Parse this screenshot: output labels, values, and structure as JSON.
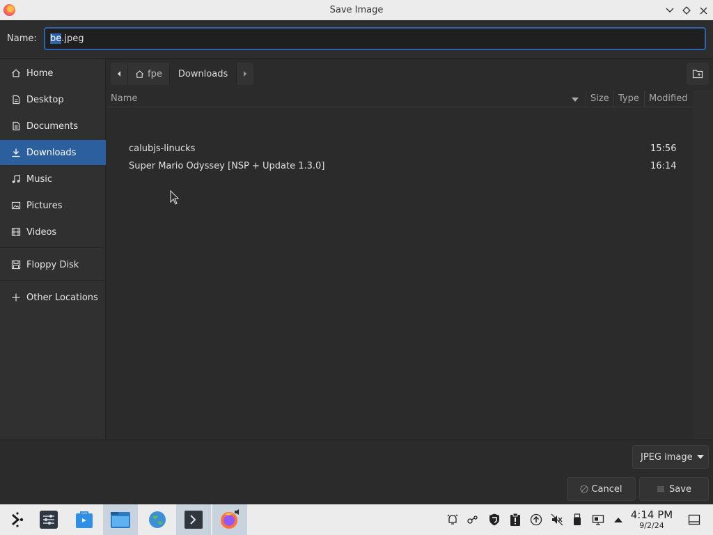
{
  "window": {
    "title": "Save Image",
    "controls": [
      "minimize",
      "restore",
      "close"
    ]
  },
  "name_field": {
    "label": "Name:",
    "value_selected": "be",
    "value_rest": ".jpeg"
  },
  "sidebar": {
    "items": [
      {
        "label": "Home",
        "icon": "home-icon",
        "active": false
      },
      {
        "label": "Desktop",
        "icon": "desktop-icon",
        "active": false
      },
      {
        "label": "Documents",
        "icon": "documents-icon",
        "active": false
      },
      {
        "label": "Downloads",
        "icon": "downloads-icon",
        "active": true
      },
      {
        "label": "Music",
        "icon": "music-icon",
        "active": false
      },
      {
        "label": "Pictures",
        "icon": "pictures-icon",
        "active": false
      },
      {
        "label": "Videos",
        "icon": "videos-icon",
        "active": false
      },
      {
        "label": "Floppy Disk",
        "icon": "floppy-icon",
        "active": false
      },
      {
        "label": "Other Locations",
        "icon": "plus-icon",
        "active": false
      }
    ]
  },
  "pathbar": {
    "home_label": "fpe",
    "current_label": "Downloads"
  },
  "file_list": {
    "columns": [
      "Name",
      "Size",
      "Type",
      "Modified"
    ],
    "rows": [
      {
        "name": "calubjs-linucks",
        "size": "",
        "type": "",
        "modified": "15:56"
      },
      {
        "name": "Super Mario Odyssey [NSP + Update 1.3.0]",
        "size": "",
        "type": "",
        "modified": "16:14"
      }
    ]
  },
  "filter": {
    "selected": "JPEG image"
  },
  "buttons": {
    "cancel": "Cancel",
    "save": "Save"
  },
  "taskbar": {
    "clock_time": "4:14 PM",
    "clock_date": "9/2/24"
  },
  "colors": {
    "accent": "#2b5f9e",
    "selection": "#2f64ad",
    "background": "#2b2b2b"
  }
}
